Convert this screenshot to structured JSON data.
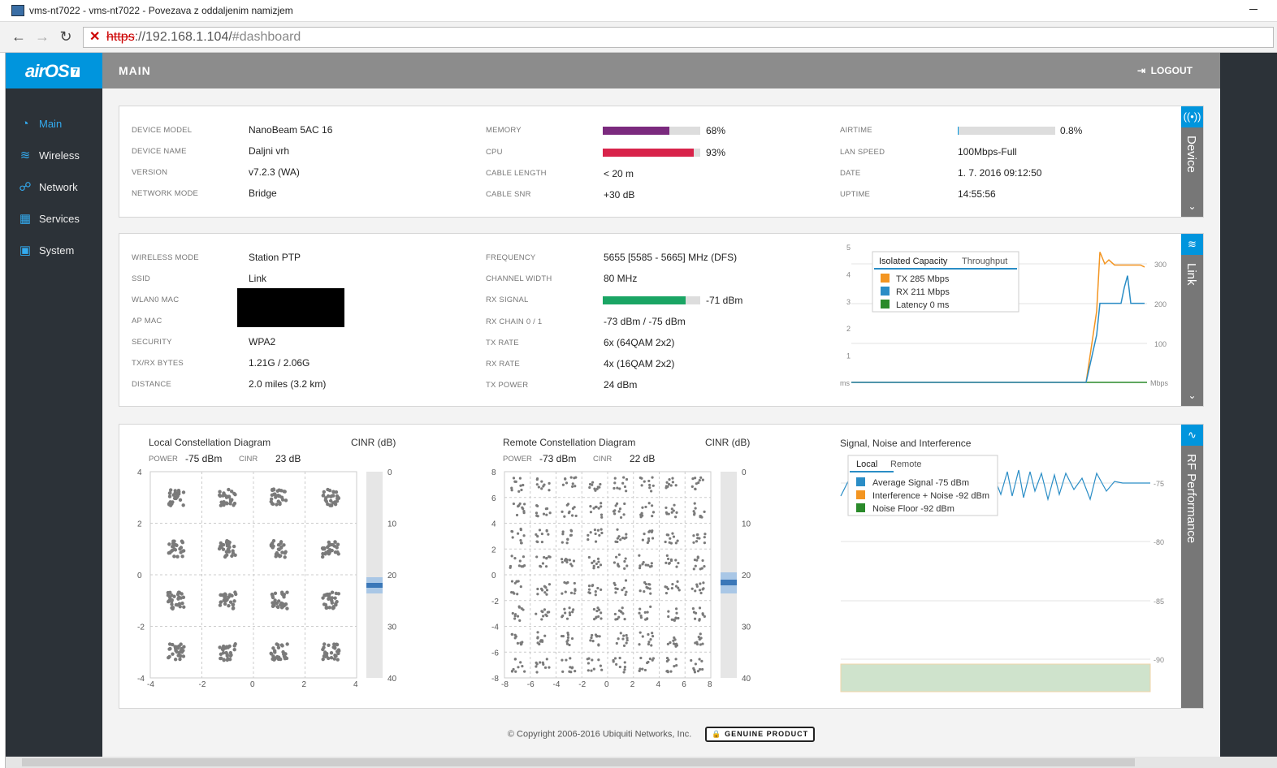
{
  "window": {
    "title": "vms-nt7022 - vms-nt7022 - Povezava z oddaljenim namizjem"
  },
  "browser": {
    "url_insecure": "https",
    "url_host": "://192.168.1.104/",
    "url_path": "#dashboard"
  },
  "brand": {
    "logo": "airOS",
    "version": "7"
  },
  "nav": [
    {
      "label": "Main",
      "icon": "speedometer-icon",
      "active": true
    },
    {
      "label": "Wireless",
      "icon": "wifi-icon"
    },
    {
      "label": "Network",
      "icon": "network-icon"
    },
    {
      "label": "Services",
      "icon": "services-icon"
    },
    {
      "label": "System",
      "icon": "chip-icon"
    }
  ],
  "header": {
    "title": "MAIN",
    "logout": "LOGOUT"
  },
  "device": {
    "tab": "Device",
    "col1": [
      {
        "label": "DEVICE MODEL",
        "value": "NanoBeam 5AC 16"
      },
      {
        "label": "DEVICE NAME",
        "value": "Daljni vrh"
      },
      {
        "label": "VERSION",
        "value": "v7.2.3 (WA)"
      },
      {
        "label": "NETWORK MODE",
        "value": "Bridge"
      }
    ],
    "memory": {
      "label": "MEMORY",
      "value": "68%",
      "fraction": 0.68,
      "color": "#7b2a7e"
    },
    "cpu": {
      "label": "CPU",
      "value": "93%",
      "fraction": 0.93,
      "color": "#d8234a"
    },
    "cable_length": {
      "label": "CABLE LENGTH",
      "value": "< 20 m"
    },
    "cable_snr": {
      "label": "CABLE SNR",
      "value": "+30 dB"
    },
    "airtime": {
      "label": "AIRTIME",
      "value": "0.8%",
      "fraction": 0.008,
      "color": "#0095dd"
    },
    "col3": [
      {
        "label": "LAN SPEED",
        "value": "100Mbps-Full"
      },
      {
        "label": "DATE",
        "value": "1. 7. 2016 09:12:50"
      },
      {
        "label": "UPTIME",
        "value": "14:55:56"
      }
    ]
  },
  "link": {
    "tab": "Link",
    "col1": [
      {
        "label": "WIRELESS MODE",
        "value": "Station PTP"
      },
      {
        "label": "SSID",
        "value": "Link"
      },
      {
        "label": "WLAN0 MAC",
        "value": ""
      },
      {
        "label": "AP MAC",
        "value": ""
      },
      {
        "label": "SECURITY",
        "value": "WPA2"
      },
      {
        "label": "TX/RX BYTES",
        "value": "1.21G / 2.06G"
      },
      {
        "label": "DISTANCE",
        "value": "2.0 miles (3.2 km)"
      }
    ],
    "col2": [
      {
        "label": "FREQUENCY",
        "value": "5655 [5585 - 5665] MHz (DFS)"
      },
      {
        "label": "CHANNEL WIDTH",
        "value": "80 MHz"
      },
      {
        "label": "RX SIGNAL",
        "value": "-71 dBm"
      },
      {
        "label": "RX CHAIN 0 / 1",
        "value": "-73 dBm / -75 dBm"
      },
      {
        "label": "TX RATE",
        "value": "6x (64QAM 2x2)"
      },
      {
        "label": "RX RATE",
        "value": "4x (16QAM 2x2)"
      },
      {
        "label": "TX POWER",
        "value": "24 dBm"
      }
    ],
    "rx_signal_fraction": 0.85,
    "rx_signal_color": "#1aa564"
  },
  "capacity_chart": {
    "tabs": [
      "Isolated Capacity",
      "Throughput"
    ],
    "legend": [
      {
        "label": "TX 285 Mbps",
        "color": "#f39521"
      },
      {
        "label": "RX 211 Mbps",
        "color": "#2a8dc6"
      },
      {
        "label": "Latency 0 ms",
        "color": "#2a8a2a"
      }
    ],
    "left_ticks": [
      "5",
      "4",
      "3",
      "2",
      "1",
      "ms"
    ],
    "right_ticks": [
      "300",
      "200",
      "100",
      "Mbps"
    ]
  },
  "rf": {
    "tab": "RF Performance",
    "local": {
      "title": "Local Constellation Diagram",
      "cinr_title": "CINR (dB)",
      "power_label": "POWER",
      "power": "-75 dBm",
      "cinr_label": "CINR",
      "cinr": "23 dB",
      "x_ticks": [
        "-4",
        "-2",
        "0",
        "2",
        "4"
      ],
      "y_ticks": [
        "4",
        "2",
        "0",
        "-2",
        "-4"
      ],
      "cinr_ticks": [
        "0",
        "10",
        "20",
        "30",
        "40"
      ]
    },
    "remote": {
      "title": "Remote Constellation Diagram",
      "cinr_title": "CINR (dB)",
      "power_label": "POWER",
      "power": "-73 dBm",
      "cinr_label": "CINR",
      "cinr": "22 dB",
      "x_ticks": [
        "-8",
        "-6",
        "-4",
        "-2",
        "0",
        "2",
        "4",
        "6",
        "8"
      ],
      "y_ticks": [
        "8",
        "6",
        "4",
        "2",
        "0",
        "-2",
        "-4",
        "-6",
        "-8"
      ],
      "cinr_ticks": [
        "0",
        "10",
        "20",
        "30",
        "40"
      ]
    },
    "sni": {
      "title": "Signal, Noise and Interference",
      "tabs": [
        "Local",
        "Remote"
      ],
      "legend": [
        {
          "label": "Average Signal -75 dBm",
          "color": "#2a8dc6"
        },
        {
          "label": "Interference + Noise -92 dBm",
          "color": "#f39521"
        },
        {
          "label": "Noise Floor -92 dBm",
          "color": "#2a8a2a"
        }
      ],
      "right_ticks": [
        "-75",
        "-80",
        "-85",
        "-90"
      ]
    }
  },
  "chart_data": [
    {
      "type": "line",
      "title": "",
      "x": [
        0,
        1,
        2,
        3,
        4,
        5,
        6,
        7,
        8,
        9,
        10
      ],
      "series": [
        {
          "name": "TX 285 Mbps",
          "values": [
            0,
            0,
            0,
            0,
            0,
            0,
            0,
            0,
            0,
            0,
            285
          ]
        },
        {
          "name": "RX 211 Mbps",
          "values": [
            0,
            0,
            0,
            0,
            0,
            0,
            0,
            0,
            0,
            0,
            211
          ]
        },
        {
          "name": "Latency 0 ms",
          "values": [
            0,
            0,
            0,
            0,
            0,
            0,
            0,
            0,
            0,
            0,
            0
          ]
        }
      ],
      "ylim_left": [
        0,
        5
      ],
      "ylim_right": [
        0,
        330
      ]
    },
    {
      "type": "line",
      "title": "Signal, Noise and Interference",
      "series": [
        {
          "name": "Average Signal -75 dBm",
          "values": [
            -76,
            -75,
            -74,
            -75,
            -76,
            -74,
            -75,
            -76,
            -75,
            -74,
            -75,
            -75
          ]
        }
      ],
      "ylim": [
        -94,
        -73
      ]
    }
  ],
  "footer": {
    "copyright": "© Copyright 2006-2016 Ubiquiti Networks, Inc.",
    "badge": "GENUINE PRODUCT"
  }
}
